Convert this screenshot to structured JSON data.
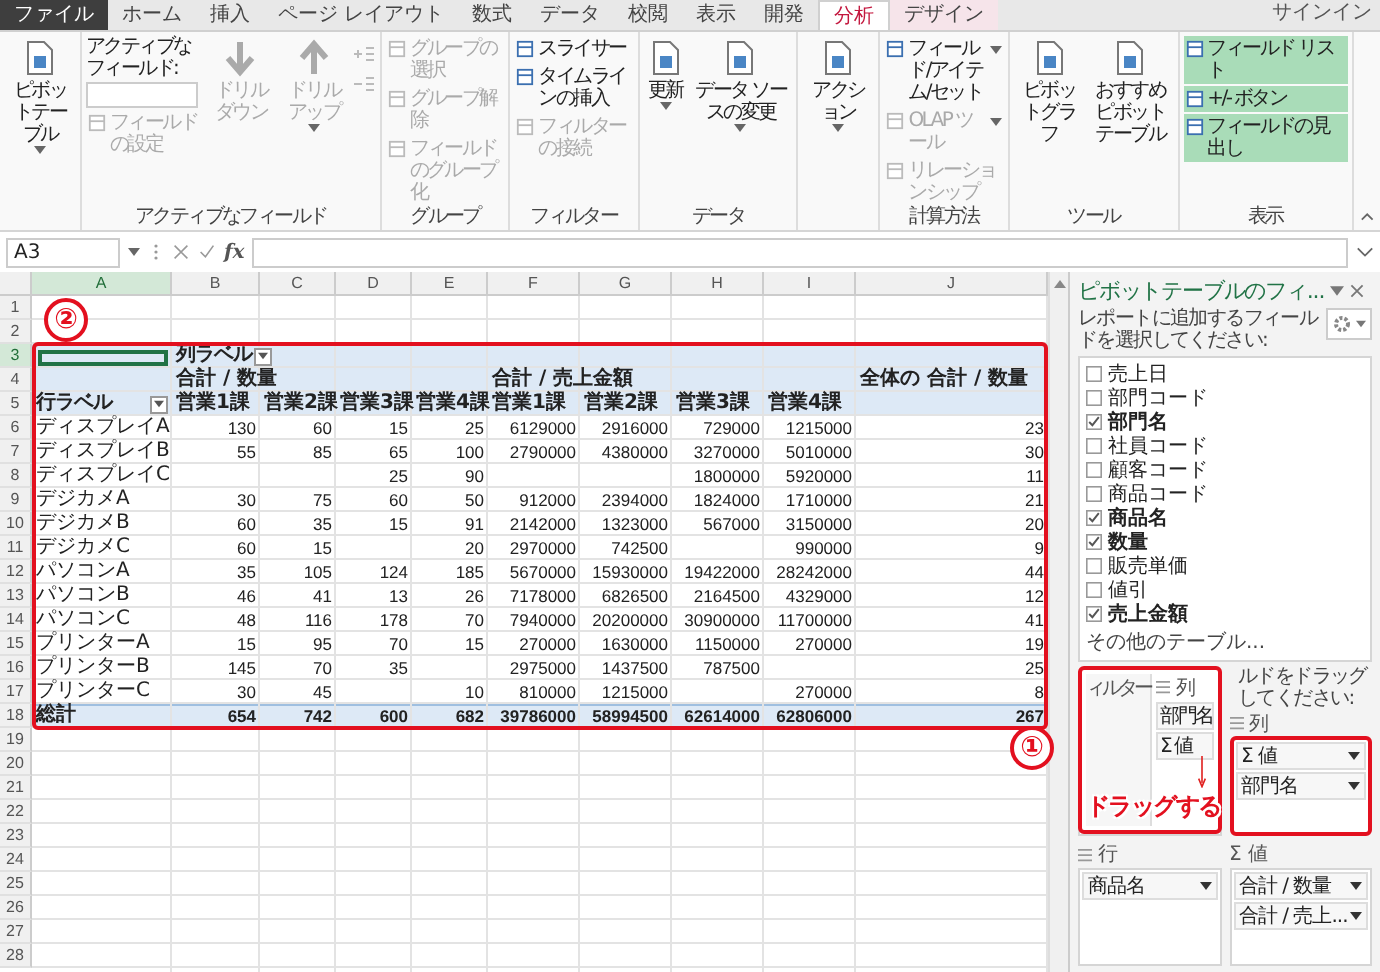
{
  "tabs": [
    {
      "label": "ファイル",
      "kind": "file",
      "selected": false
    },
    {
      "label": "ホーム",
      "kind": "normal",
      "selected": false
    },
    {
      "label": "挿入",
      "kind": "normal",
      "selected": false
    },
    {
      "label": "ページ レイアウト",
      "kind": "normal",
      "selected": false
    },
    {
      "label": "数式",
      "kind": "normal",
      "selected": false
    },
    {
      "label": "データ",
      "kind": "normal",
      "selected": false
    },
    {
      "label": "校閲",
      "kind": "normal",
      "selected": false
    },
    {
      "label": "表示",
      "kind": "normal",
      "selected": false
    },
    {
      "label": "開発",
      "kind": "normal",
      "selected": false
    },
    {
      "label": "分析",
      "kind": "context",
      "selected": true
    },
    {
      "label": "デザイン",
      "kind": "context",
      "selected": false
    }
  ],
  "account": "サインイン",
  "ribbon": [
    {
      "columns": [
        [
          {
            "kind": "large",
            "label": "ピボットテーブル",
            "dropdown": true,
            "disabled": false
          }
        ]
      ]
    },
    {
      "label": "アクティブなフィールド",
      "columns": [
        [
          {
            "kind": "caption",
            "label": "アクティブなフィールド:"
          },
          {
            "kind": "field"
          },
          {
            "kind": "small",
            "label": "フィールドの設定",
            "dropdown": false,
            "disabled": true
          }
        ],
        [
          {
            "kind": "drill-down",
            "label": "ドリルダウン",
            "dropdown": false,
            "disabled": true
          }
        ],
        [
          {
            "kind": "drill-up",
            "label": "ドリルアップ",
            "dropdown": true,
            "disabled": true
          }
        ],
        [
          {
            "kind": "expand"
          },
          {
            "kind": "collapse"
          }
        ]
      ]
    },
    {
      "label": "グループ",
      "columns": [
        [
          {
            "kind": "small",
            "label": "グループの選択",
            "dropdown": false,
            "disabled": true
          },
          {
            "kind": "small",
            "label": "グループ解除",
            "dropdown": false,
            "disabled": true
          },
          {
            "kind": "small",
            "label": "フィールドのグループ化",
            "dropdown": false,
            "disabled": true
          }
        ]
      ]
    },
    {
      "label": "フィルター",
      "columns": [
        [
          {
            "kind": "small",
            "label": "スライサー",
            "dropdown": false,
            "disabled": false
          },
          {
            "kind": "small",
            "label": "タイムラインの挿入",
            "dropdown": false,
            "disabled": false
          },
          {
            "kind": "small",
            "label": "フィルターの接続",
            "dropdown": false,
            "disabled": true
          }
        ]
      ]
    },
    {
      "label": "データ",
      "columns": [
        [
          {
            "kind": "large",
            "label": "更新",
            "dropdown": true,
            "disabled": false
          }
        ],
        [
          {
            "kind": "large",
            "label": "データ ソースの変更",
            "dropdown": true,
            "disabled": false
          }
        ]
      ]
    },
    {
      "columns": [
        [
          {
            "kind": "large",
            "label": "アクション",
            "dropdown": true,
            "disabled": false
          }
        ]
      ]
    },
    {
      "label": "計算方法",
      "columns": [
        [
          {
            "kind": "small",
            "label": "フィールド/アイテム/セット",
            "dropdown": true,
            "disabled": false
          },
          {
            "kind": "small",
            "label": "OLAP ツール",
            "dropdown": true,
            "disabled": true
          },
          {
            "kind": "small",
            "label": "リレーションシップ",
            "dropdown": false,
            "disabled": true
          }
        ]
      ]
    },
    {
      "label": "ツール",
      "columns": [
        [
          {
            "kind": "large",
            "label": "ピボットグラフ",
            "dropdown": false,
            "disabled": false
          }
        ],
        [
          {
            "kind": "large",
            "label": "おすすめピボットテーブル",
            "dropdown": false,
            "disabled": false
          }
        ]
      ]
    },
    {
      "label": "表示",
      "columns": [
        [
          {
            "kind": "small",
            "label": "フィールド リスト",
            "dropdown": false,
            "disabled": false,
            "on": true
          },
          {
            "kind": "small",
            "label": "+/- ボタン",
            "dropdown": false,
            "disabled": false,
            "on": true
          },
          {
            "kind": "small",
            "label": "フィールドの見出し",
            "dropdown": false,
            "disabled": false,
            "on": true
          }
        ]
      ]
    }
  ],
  "formula_bar": {
    "name_box": "A3",
    "function_label": "fx"
  },
  "sheet": {
    "columns": [
      {
        "letter": "A",
        "selected": true
      },
      {
        "letter": "B",
        "selected": false
      },
      {
        "letter": "C",
        "selected": false
      },
      {
        "letter": "D",
        "selected": false
      },
      {
        "letter": "E",
        "selected": false
      },
      {
        "letter": "F",
        "selected": false
      },
      {
        "letter": "G",
        "selected": false
      },
      {
        "letter": "H",
        "selected": false
      },
      {
        "letter": "I",
        "selected": false
      },
      {
        "letter": "J",
        "selected": false
      }
    ],
    "rows": [
      {
        "number": "1",
        "selected": false
      },
      {
        "number": "2",
        "selected": false
      },
      {
        "number": "3",
        "selected": true
      },
      {
        "number": "4",
        "selected": false
      },
      {
        "number": "5",
        "selected": false
      },
      {
        "number": "6",
        "selected": false
      },
      {
        "number": "7",
        "selected": false
      },
      {
        "number": "8",
        "selected": false
      },
      {
        "number": "9",
        "selected": false
      },
      {
        "number": "10",
        "selected": false
      },
      {
        "number": "11",
        "selected": false
      },
      {
        "number": "12",
        "selected": false
      },
      {
        "number": "13",
        "selected": false
      },
      {
        "number": "14",
        "selected": false
      },
      {
        "number": "15",
        "selected": false
      },
      {
        "number": "16",
        "selected": false
      },
      {
        "number": "17",
        "selected": false
      },
      {
        "number": "18",
        "selected": false
      },
      {
        "number": "19",
        "selected": false
      },
      {
        "number": "20",
        "selected": false
      },
      {
        "number": "21",
        "selected": false
      },
      {
        "number": "22",
        "selected": false
      },
      {
        "number": "23",
        "selected": false
      },
      {
        "number": "24",
        "selected": false
      },
      {
        "number": "25",
        "selected": false
      },
      {
        "number": "26",
        "selected": false
      },
      {
        "number": "27",
        "selected": false
      },
      {
        "number": "28",
        "selected": false
      }
    ]
  },
  "pivot": {
    "column_label_header": "列ラベル",
    "row_label_header": "行ラベル",
    "grand_total_header": "全体の 合計 / 数量",
    "measures": [
      {
        "title": "合計 / 数量",
        "departments": [
          "営業1課",
          "営業2課",
          "営業3課",
          "営業4課"
        ]
      },
      {
        "title": "合計 / 売上金額",
        "departments": [
          "営業1課",
          "営業2課",
          "営業3課",
          "営業4課"
        ]
      }
    ],
    "rows": [
      {
        "label": "ディスプレイA",
        "quantity_1": "130",
        "quantity_2": "60",
        "quantity_3": "15",
        "quantity_4": "25",
        "amount_1": "6129000",
        "amount_2": "2916000",
        "amount_3": "729000",
        "amount_4": "1215000",
        "total": "23"
      },
      {
        "label": "ディスプレイB",
        "quantity_1": "55",
        "quantity_2": "85",
        "quantity_3": "65",
        "quantity_4": "100",
        "amount_1": "2790000",
        "amount_2": "4380000",
        "amount_3": "3270000",
        "amount_4": "5010000",
        "total": "30"
      },
      {
        "label": "ディスプレイC",
        "quantity_3": "25",
        "quantity_4": "90",
        "amount_3": "1800000",
        "amount_4": "5920000",
        "total": "11"
      },
      {
        "label": "デジカメA",
        "quantity_1": "30",
        "quantity_2": "75",
        "quantity_3": "60",
        "quantity_4": "50",
        "amount_1": "912000",
        "amount_2": "2394000",
        "amount_3": "1824000",
        "amount_4": "1710000",
        "total": "21"
      },
      {
        "label": "デジカメB",
        "quantity_1": "60",
        "quantity_2": "35",
        "quantity_3": "15",
        "quantity_4": "91",
        "amount_1": "2142000",
        "amount_2": "1323000",
        "amount_3": "567000",
        "amount_4": "3150000",
        "total": "20"
      },
      {
        "label": "デジカメC",
        "quantity_1": "60",
        "quantity_2": "15",
        "quantity_4": "20",
        "amount_1": "2970000",
        "amount_2": "742500",
        "amount_4": "990000",
        "total": "9"
      },
      {
        "label": "パソコンA",
        "quantity_1": "35",
        "quantity_2": "105",
        "quantity_3": "124",
        "quantity_4": "185",
        "amount_1": "5670000",
        "amount_2": "15930000",
        "amount_3": "19422000",
        "amount_4": "28242000",
        "total": "44"
      },
      {
        "label": "パソコンB",
        "quantity_1": "46",
        "quantity_2": "41",
        "quantity_3": "13",
        "quantity_4": "26",
        "amount_1": "7178000",
        "amount_2": "6826500",
        "amount_3": "2164500",
        "amount_4": "4329000",
        "total": "12"
      },
      {
        "label": "パソコンC",
        "quantity_1": "48",
        "quantity_2": "116",
        "quantity_3": "178",
        "quantity_4": "70",
        "amount_1": "7940000",
        "amount_2": "20200000",
        "amount_3": "30900000",
        "amount_4": "11700000",
        "total": "41"
      },
      {
        "label": "プリンターA",
        "quantity_1": "15",
        "quantity_2": "95",
        "quantity_3": "70",
        "quantity_4": "15",
        "amount_1": "270000",
        "amount_2": "1630000",
        "amount_3": "1150000",
        "amount_4": "270000",
        "total": "19"
      },
      {
        "label": "プリンターB",
        "quantity_1": "145",
        "quantity_2": "70",
        "quantity_3": "35",
        "amount_1": "2975000",
        "amount_2": "1437500",
        "amount_3": "787500",
        "total": "25"
      },
      {
        "label": "プリンターC",
        "quantity_1": "30",
        "quantity_2": "45",
        "quantity_4": "10",
        "amount_1": "810000",
        "amount_2": "1215000",
        "amount_4": "270000",
        "total": "8"
      }
    ],
    "total_row": {
      "label": "総計",
      "quantity_1": "654",
      "quantity_2": "742",
      "quantity_3": "600",
      "quantity_4": "682",
      "amount_1": "39786000",
      "amount_2": "58994500",
      "amount_3": "62614000",
      "amount_4": "62806000",
      "total": "267"
    }
  },
  "pane": {
    "title": "ピボットテーブルのフィ...",
    "hint": "レポートに追加するフィールドを選択してください:",
    "fields": [
      {
        "label": "売上日",
        "checked": false
      },
      {
        "label": "部門コード",
        "checked": false
      },
      {
        "label": "部門名",
        "checked": true
      },
      {
        "label": "社員コード",
        "checked": false
      },
      {
        "label": "顧客コード",
        "checked": false
      },
      {
        "label": "商品コード",
        "checked": false
      },
      {
        "label": "商品名",
        "checked": true
      },
      {
        "label": "数量",
        "checked": true
      },
      {
        "label": "販売単価",
        "checked": false
      },
      {
        "label": "値引",
        "checked": false
      },
      {
        "label": "売上金額",
        "checked": true
      }
    ],
    "more_tables": "その他のテーブル...",
    "drag_hint": "ルドをドラッグしてください:",
    "areas": [
      {
        "kind": "columns",
        "label": "列",
        "items": [
          "Σ 値",
          "部門名"
        ],
        "highlighted": true
      },
      {
        "kind": "rows",
        "label": "行",
        "items": [
          "商品名"
        ],
        "highlighted": false
      },
      {
        "kind": "values",
        "label": "Σ 値",
        "items": [
          "合計 / 数量",
          "合計 / 売上..."
        ],
        "highlighted": false
      }
    ]
  },
  "annotations": {
    "table_marker": "②",
    "callout": {
      "marker": "①",
      "filter_label": "ィルター",
      "area_label": "列",
      "items": [
        "部門名",
        "Σ 値"
      ],
      "action": "ドラッグする"
    }
  }
}
